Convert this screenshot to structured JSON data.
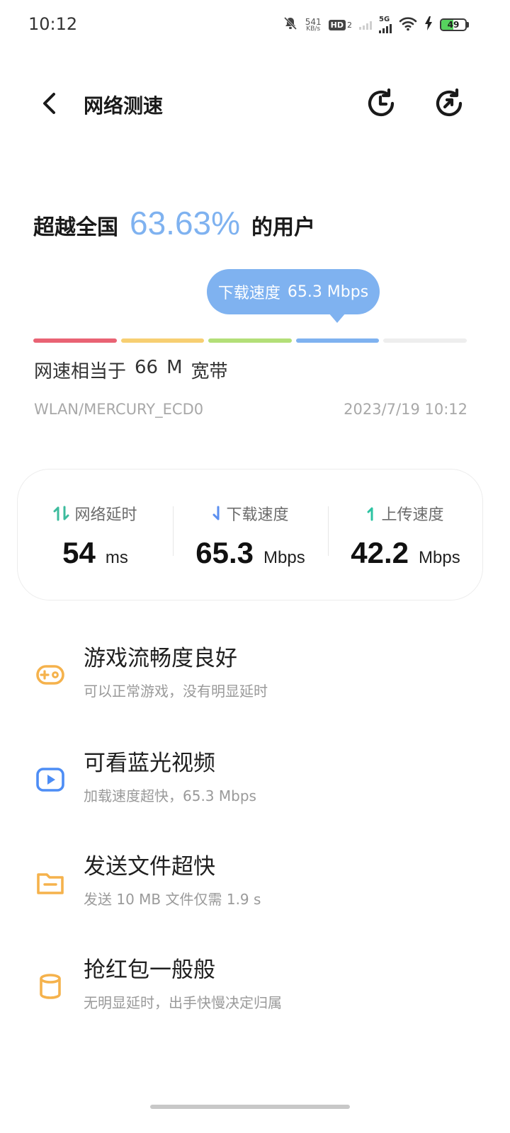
{
  "status_bar": {
    "time": "10:12",
    "net_speed_value": "541",
    "net_speed_unit": "KB/s",
    "hd_label": "HD",
    "hd_sub": "2",
    "network_label": "5G",
    "battery_level": 49,
    "battery_text": "49",
    "icons": [
      "bell-muted-icon",
      "wifi-icon",
      "charging-bolt-icon"
    ]
  },
  "header": {
    "title": "网络测速",
    "back_icon": "chevron-left-icon",
    "history_icon": "history-clock-icon",
    "retest_icon": "refresh-icon"
  },
  "summary": {
    "prefix": "超越全国",
    "percent": "63.63%",
    "suffix": "的用户"
  },
  "bubble": {
    "label": "下载速度",
    "value": "65.3 Mbps"
  },
  "meter": {
    "colors": [
      "#e96374",
      "#f7cf72",
      "#b3df78",
      "#7fb2f0",
      "#eeeeee"
    ],
    "active_index": 3
  },
  "equivalent": {
    "prefix": "网速相当于",
    "value": "66",
    "unit": "M",
    "suffix": "宽带"
  },
  "meta": {
    "network": "WLAN/MERCURY_ECD0",
    "datetime": "2023/7/19  10:12"
  },
  "stats": [
    {
      "label": "网络延时",
      "value": "54",
      "unit": "ms",
      "icon": "latency-arrows-icon",
      "color": "#3dbb9d"
    },
    {
      "label": "下载速度",
      "value": "65.3",
      "unit": "Mbps",
      "icon": "download-arrow-icon",
      "color": "#5b8ff0"
    },
    {
      "label": "上传速度",
      "value": "42.2",
      "unit": "Mbps",
      "icon": "upload-arrow-icon",
      "color": "#2cc3a2"
    }
  ],
  "features": [
    {
      "title": "游戏流畅度良好",
      "desc": "可以正常游戏，没有明显延时",
      "icon": "gamepad-icon",
      "color": "#f5b24c"
    },
    {
      "title": "可看蓝光视频",
      "desc": "加载速度超快，65.3  Mbps",
      "icon": "video-play-icon",
      "color": "#4d8df5"
    },
    {
      "title": "发送文件超快",
      "desc": "发送  10  MB  文件仅需  1.9  s",
      "icon": "folder-icon",
      "color": "#f5b24c"
    },
    {
      "title": "抢红包一般般",
      "desc": "无明显延时，出手快慢决定归属",
      "icon": "cylinder-icon",
      "color": "#f5b24c"
    }
  ]
}
